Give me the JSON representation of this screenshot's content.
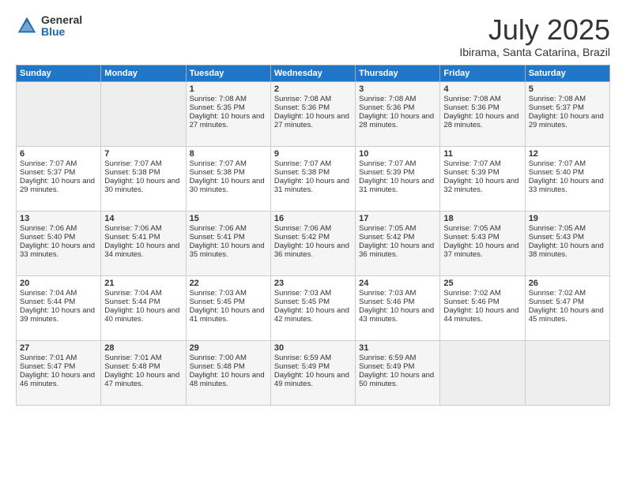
{
  "logo": {
    "general": "General",
    "blue": "Blue"
  },
  "title": "July 2025",
  "subtitle": "Ibirama, Santa Catarina, Brazil",
  "days_header": [
    "Sunday",
    "Monday",
    "Tuesday",
    "Wednesday",
    "Thursday",
    "Friday",
    "Saturday"
  ],
  "weeks": [
    [
      {
        "day": "",
        "empty": true
      },
      {
        "day": "",
        "empty": true
      },
      {
        "day": "1",
        "sun": "Sunrise: 7:08 AM",
        "set": "Sunset: 5:35 PM",
        "day_hrs": "Daylight: 10 hours and 27 minutes."
      },
      {
        "day": "2",
        "sun": "Sunrise: 7:08 AM",
        "set": "Sunset: 5:36 PM",
        "day_hrs": "Daylight: 10 hours and 27 minutes."
      },
      {
        "day": "3",
        "sun": "Sunrise: 7:08 AM",
        "set": "Sunset: 5:36 PM",
        "day_hrs": "Daylight: 10 hours and 28 minutes."
      },
      {
        "day": "4",
        "sun": "Sunrise: 7:08 AM",
        "set": "Sunset: 5:36 PM",
        "day_hrs": "Daylight: 10 hours and 28 minutes."
      },
      {
        "day": "5",
        "sun": "Sunrise: 7:08 AM",
        "set": "Sunset: 5:37 PM",
        "day_hrs": "Daylight: 10 hours and 29 minutes."
      }
    ],
    [
      {
        "day": "6",
        "sun": "Sunrise: 7:07 AM",
        "set": "Sunset: 5:37 PM",
        "day_hrs": "Daylight: 10 hours and 29 minutes."
      },
      {
        "day": "7",
        "sun": "Sunrise: 7:07 AM",
        "set": "Sunset: 5:38 PM",
        "day_hrs": "Daylight: 10 hours and 30 minutes."
      },
      {
        "day": "8",
        "sun": "Sunrise: 7:07 AM",
        "set": "Sunset: 5:38 PM",
        "day_hrs": "Daylight: 10 hours and 30 minutes."
      },
      {
        "day": "9",
        "sun": "Sunrise: 7:07 AM",
        "set": "Sunset: 5:38 PM",
        "day_hrs": "Daylight: 10 hours and 31 minutes."
      },
      {
        "day": "10",
        "sun": "Sunrise: 7:07 AM",
        "set": "Sunset: 5:39 PM",
        "day_hrs": "Daylight: 10 hours and 31 minutes."
      },
      {
        "day": "11",
        "sun": "Sunrise: 7:07 AM",
        "set": "Sunset: 5:39 PM",
        "day_hrs": "Daylight: 10 hours and 32 minutes."
      },
      {
        "day": "12",
        "sun": "Sunrise: 7:07 AM",
        "set": "Sunset: 5:40 PM",
        "day_hrs": "Daylight: 10 hours and 33 minutes."
      }
    ],
    [
      {
        "day": "13",
        "sun": "Sunrise: 7:06 AM",
        "set": "Sunset: 5:40 PM",
        "day_hrs": "Daylight: 10 hours and 33 minutes."
      },
      {
        "day": "14",
        "sun": "Sunrise: 7:06 AM",
        "set": "Sunset: 5:41 PM",
        "day_hrs": "Daylight: 10 hours and 34 minutes."
      },
      {
        "day": "15",
        "sun": "Sunrise: 7:06 AM",
        "set": "Sunset: 5:41 PM",
        "day_hrs": "Daylight: 10 hours and 35 minutes."
      },
      {
        "day": "16",
        "sun": "Sunrise: 7:06 AM",
        "set": "Sunset: 5:42 PM",
        "day_hrs": "Daylight: 10 hours and 36 minutes."
      },
      {
        "day": "17",
        "sun": "Sunrise: 7:05 AM",
        "set": "Sunset: 5:42 PM",
        "day_hrs": "Daylight: 10 hours and 36 minutes."
      },
      {
        "day": "18",
        "sun": "Sunrise: 7:05 AM",
        "set": "Sunset: 5:43 PM",
        "day_hrs": "Daylight: 10 hours and 37 minutes."
      },
      {
        "day": "19",
        "sun": "Sunrise: 7:05 AM",
        "set": "Sunset: 5:43 PM",
        "day_hrs": "Daylight: 10 hours and 38 minutes."
      }
    ],
    [
      {
        "day": "20",
        "sun": "Sunrise: 7:04 AM",
        "set": "Sunset: 5:44 PM",
        "day_hrs": "Daylight: 10 hours and 39 minutes."
      },
      {
        "day": "21",
        "sun": "Sunrise: 7:04 AM",
        "set": "Sunset: 5:44 PM",
        "day_hrs": "Daylight: 10 hours and 40 minutes."
      },
      {
        "day": "22",
        "sun": "Sunrise: 7:03 AM",
        "set": "Sunset: 5:45 PM",
        "day_hrs": "Daylight: 10 hours and 41 minutes."
      },
      {
        "day": "23",
        "sun": "Sunrise: 7:03 AM",
        "set": "Sunset: 5:45 PM",
        "day_hrs": "Daylight: 10 hours and 42 minutes."
      },
      {
        "day": "24",
        "sun": "Sunrise: 7:03 AM",
        "set": "Sunset: 5:46 PM",
        "day_hrs": "Daylight: 10 hours and 43 minutes."
      },
      {
        "day": "25",
        "sun": "Sunrise: 7:02 AM",
        "set": "Sunset: 5:46 PM",
        "day_hrs": "Daylight: 10 hours and 44 minutes."
      },
      {
        "day": "26",
        "sun": "Sunrise: 7:02 AM",
        "set": "Sunset: 5:47 PM",
        "day_hrs": "Daylight: 10 hours and 45 minutes."
      }
    ],
    [
      {
        "day": "27",
        "sun": "Sunrise: 7:01 AM",
        "set": "Sunset: 5:47 PM",
        "day_hrs": "Daylight: 10 hours and 46 minutes."
      },
      {
        "day": "28",
        "sun": "Sunrise: 7:01 AM",
        "set": "Sunset: 5:48 PM",
        "day_hrs": "Daylight: 10 hours and 47 minutes."
      },
      {
        "day": "29",
        "sun": "Sunrise: 7:00 AM",
        "set": "Sunset: 5:48 PM",
        "day_hrs": "Daylight: 10 hours and 48 minutes."
      },
      {
        "day": "30",
        "sun": "Sunrise: 6:59 AM",
        "set": "Sunset: 5:49 PM",
        "day_hrs": "Daylight: 10 hours and 49 minutes."
      },
      {
        "day": "31",
        "sun": "Sunrise: 6:59 AM",
        "set": "Sunset: 5:49 PM",
        "day_hrs": "Daylight: 10 hours and 50 minutes."
      },
      {
        "day": "",
        "empty": true
      },
      {
        "day": "",
        "empty": true
      }
    ]
  ]
}
